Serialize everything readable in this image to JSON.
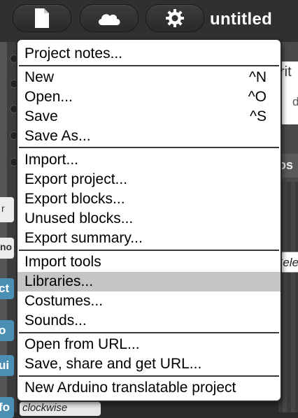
{
  "topbar": {
    "file_icon": "file-icon",
    "cloud_icon": "cloud-icon",
    "settings_icon": "gear-icon",
    "project_title": "untitled"
  },
  "menu": {
    "items": [
      {
        "label": "Project notes...",
        "shortcut": ""
      },
      {
        "label": "New",
        "shortcut": "^N"
      },
      {
        "label": "Open...",
        "shortcut": "^O"
      },
      {
        "label": "Save",
        "shortcut": "^S"
      },
      {
        "label": "Save As...",
        "shortcut": ""
      },
      {
        "label": "Import...",
        "shortcut": ""
      },
      {
        "label": "Export project...",
        "shortcut": ""
      },
      {
        "label": "Export blocks...",
        "shortcut": ""
      },
      {
        "label": "Unused blocks...",
        "shortcut": ""
      },
      {
        "label": "Export summary...",
        "shortcut": ""
      },
      {
        "label": "Import tools",
        "shortcut": ""
      },
      {
        "label": "Libraries...",
        "shortcut": ""
      },
      {
        "label": "Costumes...",
        "shortcut": ""
      },
      {
        "label": "Sounds...",
        "shortcut": ""
      },
      {
        "label": "Open from URL...",
        "shortcut": ""
      },
      {
        "label": "Save, share and get URL...",
        "shortcut": ""
      },
      {
        "label": "New Arduino translatable project",
        "shortcut": ""
      }
    ],
    "highlighted_item": "Libraries...",
    "highlight_color": "#c5c5c5"
  },
  "background": {
    "left_tab_1": "r",
    "left_tab_2": "no",
    "blocks": [
      "ct",
      "o",
      "ui",
      "fo"
    ],
    "block_color": "#4b8fb5",
    "sprite_label": "rit",
    "sprite_sub": "d",
    "stage_label": "os",
    "tooltip": "Sele",
    "dropdown_value": "clockwise"
  }
}
